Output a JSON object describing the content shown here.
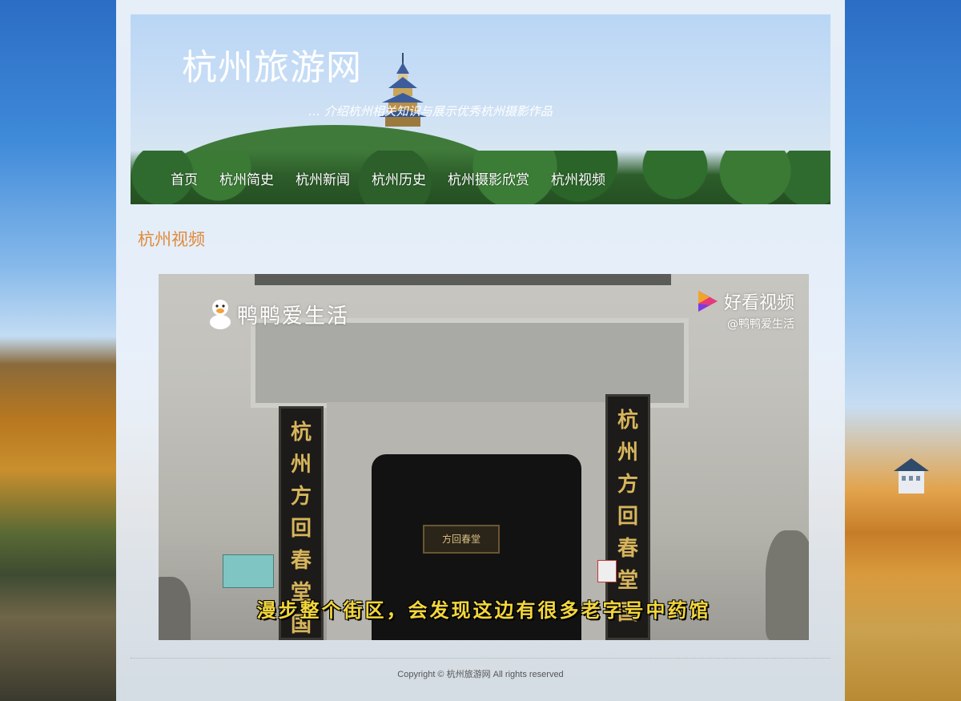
{
  "site": {
    "title": "杭州旅游网",
    "subtitle": "介绍杭州相关知识与展示优秀杭州摄影作品"
  },
  "nav": {
    "items": [
      {
        "label": "首页"
      },
      {
        "label": "杭州简史"
      },
      {
        "label": "杭州新闻"
      },
      {
        "label": "杭州历史"
      },
      {
        "label": "杭州摄影欣赏"
      },
      {
        "label": "杭州视频"
      }
    ]
  },
  "page": {
    "heading": "杭州视频"
  },
  "video": {
    "channel_watermark": "鸭鸭爱生活",
    "platform_name": "好看视频",
    "platform_handle": "@鸭鸭爱生活",
    "caption": "漫步整个街区，会发现这边有很多老字号中药馆",
    "couplet_left": [
      "杭",
      "州",
      "方",
      "回",
      "春",
      "堂",
      "国"
    ],
    "couplet_right": [
      "杭",
      "州",
      "方",
      "回",
      "春",
      "堂",
      "国"
    ],
    "door_sign": "方回春堂"
  },
  "footer": {
    "copyright": "Copyright © 杭州旅游网 All rights reserved"
  },
  "colors": {
    "heading": "#e08a3a",
    "caption": "#f3d63c"
  }
}
